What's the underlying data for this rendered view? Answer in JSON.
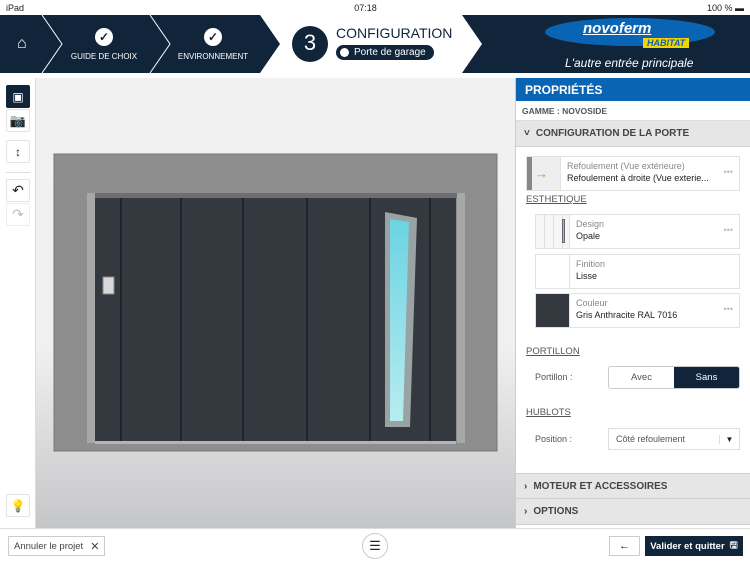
{
  "status": {
    "device": "iPad",
    "time": "07:18",
    "battery": "100 %"
  },
  "header": {
    "steps": [
      {
        "label": "GUIDE DE CHOIX",
        "done": true
      },
      {
        "label": "ENVIRONNEMENT",
        "done": true
      }
    ],
    "current": {
      "number": "3",
      "title": "CONFIGURATION",
      "subtitle": "Porte de garage"
    },
    "logo": {
      "brand": "novoferm",
      "sub": "HABITAT",
      "tagline": "L'autre entrée principale"
    }
  },
  "toolbar": {
    "icons": [
      "door-view-icon",
      "camera-icon",
      "dimensions-icon",
      "undo-icon",
      "redo-icon",
      "lightbulb-icon"
    ]
  },
  "door": {
    "color": "#33393f",
    "wall": "#8e8e8e",
    "glass": "#7fd6e4"
  },
  "panel": {
    "title": "PROPRIÉTÉS",
    "gamme": "GAMME : NOVOSIDE",
    "section_config": "CONFIGURATION DE LA PORTE",
    "refoulement": {
      "label": "Refoulement (Vue extérieure)",
      "value": "Refoulement à droite (Vue exterie..."
    },
    "esthetique": "ESTHETIQUE",
    "design": {
      "label": "Design",
      "value": "Opale"
    },
    "finition": {
      "label": "Finition",
      "value": "Lisse"
    },
    "couleur": {
      "label": "Couleur",
      "value": "Gris Anthracite RAL 7016",
      "swatch": "#33393f"
    },
    "portillon_title": "PORTILLON",
    "portillon_label": "Portillon :",
    "portillon_options": [
      "Avec",
      "Sans"
    ],
    "portillon_selected": "Sans",
    "hublots_title": "HUBLOTS",
    "position_label": "Position :",
    "position_value": "Côté refoulement",
    "section_moteur": "MOTEUR ET ACCESSOIRES",
    "section_options": "OPTIONS"
  },
  "bottom": {
    "cancel": "Annuler le projet",
    "validate": "Valider et quitter"
  },
  "colors": {
    "navy": "#10243a",
    "accent": "#0a64b4"
  }
}
